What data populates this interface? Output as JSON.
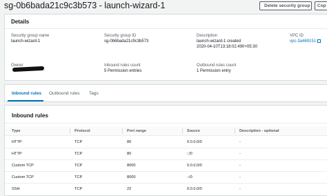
{
  "page": {
    "title": "sg-0b6bada21c9c3b573 - launch-wizard-1",
    "delete_button": "Delete security group",
    "copy_button": "Cop"
  },
  "details": {
    "header": "Details",
    "fields": {
      "sg_name_label": "Security group name",
      "sg_name_value": "launch-wizard-1",
      "sg_id_label": "Security group ID",
      "sg_id_value": "sg-0b6bada21c9c3b573",
      "description_label": "Description",
      "description_line1": "launch-wizard-1 created",
      "description_line2": "2020-04-10T13:18:02.490+05:30",
      "vpc_id_label": "VPC ID",
      "vpc_id_value": "vpc-3a469151",
      "owner_label": "Owner",
      "inbound_count_label": "Inbound rules count",
      "inbound_count_value": "5 Permission entries",
      "outbound_count_label": "Outbound rules count",
      "outbound_count_value": "1 Permission entry"
    }
  },
  "tabs": [
    {
      "label": "Inbound rules",
      "active": true
    },
    {
      "label": "Outbound rules",
      "active": false
    },
    {
      "label": "Tags",
      "active": false
    }
  ],
  "inbound": {
    "header": "Inbound rules",
    "columns": [
      "Type",
      "Protocol",
      "Port range",
      "Source",
      "Description - optional"
    ],
    "rows": [
      [
        "HTTP",
        "TCP",
        "80",
        "0.0.0.0/0",
        "-"
      ],
      [
        "HTTP",
        "TCP",
        "80",
        "::/0",
        "-"
      ],
      [
        "Custom TCP",
        "TCP",
        "8000",
        "0.0.0.0/0",
        "-"
      ],
      [
        "Custom TCP",
        "TCP",
        "8000",
        "::/0",
        "-"
      ],
      [
        "SSH",
        "TCP",
        "22",
        "0.0.0.0/0",
        "-"
      ]
    ]
  },
  "colors": {
    "accent": "#0073bb",
    "text": "#16191f",
    "muted": "#545b64"
  }
}
